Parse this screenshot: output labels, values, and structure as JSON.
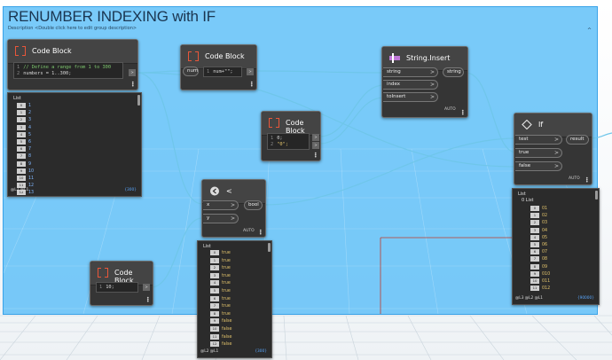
{
  "group": {
    "title": "RENUMBER INDEXING with IF",
    "description": "Description <Double click here to edit group description>",
    "collapse_glyph": "^"
  },
  "colors": {
    "group_fill": "#5cbef8",
    "node_body": "#353535",
    "codeblock_icon": "#e8563a",
    "wire": "#6fc6ea",
    "number_text": "#7fb6ff",
    "bool_text": "#e2c36b",
    "count_text": "#59a7ff"
  },
  "nodes": {
    "code_block_main": {
      "title": "Code Block",
      "icon": "code-block-icon",
      "lines": [
        {
          "no": "1",
          "text": "// Define a range from 1 to 300"
        },
        {
          "no": "2",
          "text": "numbers = 1..300;"
        }
      ],
      "out_glyph": ">"
    },
    "code_block_num": {
      "title": "Code Block",
      "icon": "code-block-icon",
      "input_port": "num",
      "lines": [
        {
          "no": "1",
          "text": "num+\"\";"
        }
      ],
      "out_glyph": ">"
    },
    "code_block_params": {
      "title": "Code Block",
      "icon": "code-block-icon",
      "lines": [
        {
          "no": "1",
          "text": "0;"
        },
        {
          "no": "2",
          "text": "\"0\";"
        }
      ],
      "out_glyphs": [
        ">",
        ">"
      ]
    },
    "string_insert": {
      "title": "String.Insert",
      "icon": "string-insert-icon",
      "inputs": [
        "string",
        "index",
        "toInsert"
      ],
      "output": "string",
      "lacing": "AUTO"
    },
    "less_than": {
      "title": "<",
      "icon": "less-than-icon",
      "inputs": [
        "x",
        "y"
      ],
      "output": "bool",
      "lacing": "AUTO"
    },
    "code_block_ten": {
      "title": "Code Block",
      "icon": "code-block-icon",
      "lines": [
        {
          "no": "1",
          "text": "10;"
        }
      ],
      "out_glyph": ">"
    },
    "if_node": {
      "title": "If",
      "icon": "if-icon",
      "inputs": [
        "test",
        "true",
        "false"
      ],
      "output": "result",
      "lacing": "AUTO"
    }
  },
  "previews": {
    "numbers": {
      "header": "List",
      "rows": [
        {
          "i": "0",
          "v": "1"
        },
        {
          "i": "1",
          "v": "2"
        },
        {
          "i": "2",
          "v": "3"
        },
        {
          "i": "3",
          "v": "4"
        },
        {
          "i": "4",
          "v": "5"
        },
        {
          "i": "5",
          "v": "6"
        },
        {
          "i": "6",
          "v": "7"
        },
        {
          "i": "7",
          "v": "8"
        },
        {
          "i": "8",
          "v": "9"
        },
        {
          "i": "9",
          "v": "10"
        },
        {
          "i": "10",
          "v": "11"
        },
        {
          "i": "11",
          "v": "12"
        },
        {
          "i": "12",
          "v": "13"
        }
      ],
      "levels": "@L2 @L1",
      "count": "{300}"
    },
    "bools": {
      "header": "List",
      "rows": [
        {
          "i": "0",
          "v": "true"
        },
        {
          "i": "1",
          "v": "true"
        },
        {
          "i": "2",
          "v": "true"
        },
        {
          "i": "3",
          "v": "true"
        },
        {
          "i": "4",
          "v": "true"
        },
        {
          "i": "5",
          "v": "true"
        },
        {
          "i": "6",
          "v": "true"
        },
        {
          "i": "7",
          "v": "true"
        },
        {
          "i": "8",
          "v": "true"
        },
        {
          "i": "9",
          "v": "false"
        },
        {
          "i": "10",
          "v": "false"
        },
        {
          "i": "11",
          "v": "false"
        },
        {
          "i": "12",
          "v": "false"
        }
      ],
      "levels": "@L2 @L1",
      "count": "{300}"
    },
    "if_result": {
      "header": "List",
      "subheader": "0 List",
      "rows": [
        {
          "i": "0",
          "v": "01"
        },
        {
          "i": "1",
          "v": "02"
        },
        {
          "i": "2",
          "v": "03"
        },
        {
          "i": "3",
          "v": "04"
        },
        {
          "i": "4",
          "v": "05"
        },
        {
          "i": "5",
          "v": "06"
        },
        {
          "i": "6",
          "v": "07"
        },
        {
          "i": "7",
          "v": "08"
        },
        {
          "i": "8",
          "v": "09"
        },
        {
          "i": "9",
          "v": "010"
        },
        {
          "i": "10",
          "v": "011"
        },
        {
          "i": "11",
          "v": "012"
        }
      ],
      "levels": "@L3 @L2 @L1",
      "count": "{90000}"
    }
  }
}
